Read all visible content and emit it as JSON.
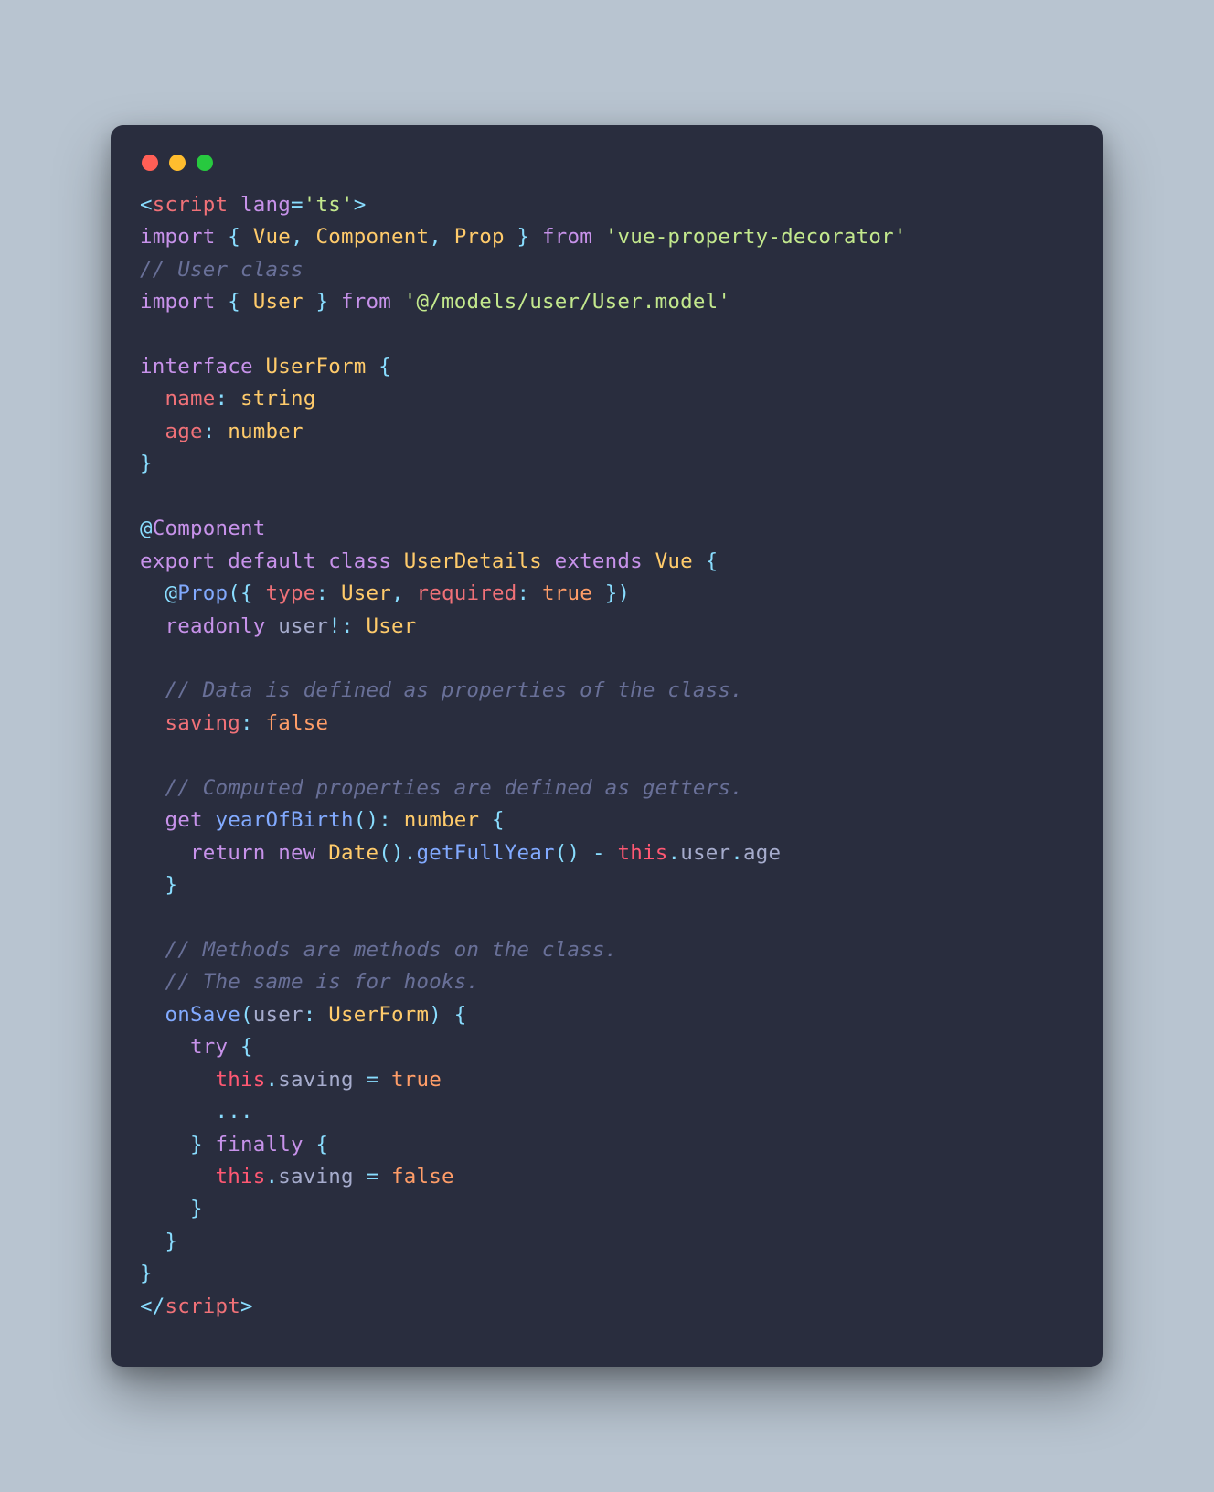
{
  "code_lines": [
    [
      {
        "t": "<",
        "c": "pun"
      },
      {
        "t": "script",
        "c": "tag"
      },
      {
        "t": " ",
        "c": "txt"
      },
      {
        "t": "lang",
        "c": "attr"
      },
      {
        "t": "=",
        "c": "pun"
      },
      {
        "t": "'ts'",
        "c": "str"
      },
      {
        "t": ">",
        "c": "pun"
      }
    ],
    [
      {
        "t": "import",
        "c": "kw"
      },
      {
        "t": " ",
        "c": "txt"
      },
      {
        "t": "{",
        "c": "pun"
      },
      {
        "t": " ",
        "c": "txt"
      },
      {
        "t": "Vue",
        "c": "type"
      },
      {
        "t": ",",
        "c": "pun"
      },
      {
        "t": " ",
        "c": "txt"
      },
      {
        "t": "Component",
        "c": "type"
      },
      {
        "t": ",",
        "c": "pun"
      },
      {
        "t": " ",
        "c": "txt"
      },
      {
        "t": "Prop",
        "c": "type"
      },
      {
        "t": " ",
        "c": "txt"
      },
      {
        "t": "}",
        "c": "pun"
      },
      {
        "t": " ",
        "c": "txt"
      },
      {
        "t": "from",
        "c": "kw"
      },
      {
        "t": " ",
        "c": "txt"
      },
      {
        "t": "'vue-property-decorator'",
        "c": "str"
      }
    ],
    [
      {
        "t": "// User class",
        "c": "comment"
      }
    ],
    [
      {
        "t": "import",
        "c": "kw"
      },
      {
        "t": " ",
        "c": "txt"
      },
      {
        "t": "{",
        "c": "pun"
      },
      {
        "t": " ",
        "c": "txt"
      },
      {
        "t": "User",
        "c": "type"
      },
      {
        "t": " ",
        "c": "txt"
      },
      {
        "t": "}",
        "c": "pun"
      },
      {
        "t": " ",
        "c": "txt"
      },
      {
        "t": "from",
        "c": "kw"
      },
      {
        "t": " ",
        "c": "txt"
      },
      {
        "t": "'@/models/user/User.model'",
        "c": "str"
      }
    ],
    [],
    [
      {
        "t": "interface",
        "c": "kw"
      },
      {
        "t": " ",
        "c": "txt"
      },
      {
        "t": "UserForm",
        "c": "type"
      },
      {
        "t": " ",
        "c": "txt"
      },
      {
        "t": "{",
        "c": "pun"
      }
    ],
    [
      {
        "t": "  ",
        "c": "txt"
      },
      {
        "t": "name",
        "c": "tag"
      },
      {
        "t": ":",
        "c": "pun"
      },
      {
        "t": " ",
        "c": "txt"
      },
      {
        "t": "string",
        "c": "type"
      }
    ],
    [
      {
        "t": "  ",
        "c": "txt"
      },
      {
        "t": "age",
        "c": "tag"
      },
      {
        "t": ":",
        "c": "pun"
      },
      {
        "t": " ",
        "c": "txt"
      },
      {
        "t": "number",
        "c": "type"
      }
    ],
    [
      {
        "t": "}",
        "c": "pun"
      }
    ],
    [],
    [
      {
        "t": "@",
        "c": "meta"
      },
      {
        "t": "Component",
        "c": "deco"
      }
    ],
    [
      {
        "t": "export",
        "c": "kw"
      },
      {
        "t": " ",
        "c": "txt"
      },
      {
        "t": "default",
        "c": "kw"
      },
      {
        "t": " ",
        "c": "txt"
      },
      {
        "t": "class",
        "c": "kw"
      },
      {
        "t": " ",
        "c": "txt"
      },
      {
        "t": "UserDetails",
        "c": "type"
      },
      {
        "t": " ",
        "c": "txt"
      },
      {
        "t": "extends",
        "c": "kw"
      },
      {
        "t": " ",
        "c": "txt"
      },
      {
        "t": "Vue",
        "c": "type"
      },
      {
        "t": " ",
        "c": "txt"
      },
      {
        "t": "{",
        "c": "pun"
      }
    ],
    [
      {
        "t": "  ",
        "c": "txt"
      },
      {
        "t": "@",
        "c": "meta"
      },
      {
        "t": "Prop",
        "c": "fn"
      },
      {
        "t": "(",
        "c": "pun"
      },
      {
        "t": "{",
        "c": "pun"
      },
      {
        "t": " ",
        "c": "txt"
      },
      {
        "t": "type",
        "c": "tag"
      },
      {
        "t": ":",
        "c": "pun"
      },
      {
        "t": " ",
        "c": "txt"
      },
      {
        "t": "User",
        "c": "type"
      },
      {
        "t": ",",
        "c": "pun"
      },
      {
        "t": " ",
        "c": "txt"
      },
      {
        "t": "required",
        "c": "tag"
      },
      {
        "t": ":",
        "c": "pun"
      },
      {
        "t": " ",
        "c": "txt"
      },
      {
        "t": "true",
        "c": "bool"
      },
      {
        "t": " ",
        "c": "txt"
      },
      {
        "t": "}",
        "c": "pun"
      },
      {
        "t": ")",
        "c": "pun"
      }
    ],
    [
      {
        "t": "  ",
        "c": "txt"
      },
      {
        "t": "readonly",
        "c": "kw"
      },
      {
        "t": " ",
        "c": "txt"
      },
      {
        "t": "user",
        "c": "txt"
      },
      {
        "t": "!",
        "c": "pun"
      },
      {
        "t": ":",
        "c": "pun"
      },
      {
        "t": " ",
        "c": "txt"
      },
      {
        "t": "User",
        "c": "type"
      }
    ],
    [],
    [
      {
        "t": "  ",
        "c": "txt"
      },
      {
        "t": "// Data is defined as properties of the class.",
        "c": "comment"
      }
    ],
    [
      {
        "t": "  ",
        "c": "txt"
      },
      {
        "t": "saving",
        "c": "tag"
      },
      {
        "t": ":",
        "c": "pun"
      },
      {
        "t": " ",
        "c": "txt"
      },
      {
        "t": "false",
        "c": "bool"
      }
    ],
    [],
    [
      {
        "t": "  ",
        "c": "txt"
      },
      {
        "t": "// Computed properties are defined as getters.",
        "c": "comment"
      }
    ],
    [
      {
        "t": "  ",
        "c": "txt"
      },
      {
        "t": "get",
        "c": "kw"
      },
      {
        "t": " ",
        "c": "txt"
      },
      {
        "t": "yearOfBirth",
        "c": "fn"
      },
      {
        "t": "(",
        "c": "pun"
      },
      {
        "t": ")",
        "c": "pun"
      },
      {
        "t": ":",
        "c": "pun"
      },
      {
        "t": " ",
        "c": "txt"
      },
      {
        "t": "number",
        "c": "type"
      },
      {
        "t": " ",
        "c": "txt"
      },
      {
        "t": "{",
        "c": "pun"
      }
    ],
    [
      {
        "t": "    ",
        "c": "txt"
      },
      {
        "t": "return",
        "c": "kw"
      },
      {
        "t": " ",
        "c": "txt"
      },
      {
        "t": "new",
        "c": "kw"
      },
      {
        "t": " ",
        "c": "txt"
      },
      {
        "t": "Date",
        "c": "type"
      },
      {
        "t": "(",
        "c": "pun"
      },
      {
        "t": ")",
        "c": "pun"
      },
      {
        "t": ".",
        "c": "pun"
      },
      {
        "t": "getFullYear",
        "c": "fn"
      },
      {
        "t": "(",
        "c": "pun"
      },
      {
        "t": ")",
        "c": "pun"
      },
      {
        "t": " ",
        "c": "txt"
      },
      {
        "t": "-",
        "c": "pun"
      },
      {
        "t": " ",
        "c": "txt"
      },
      {
        "t": "this",
        "c": "this"
      },
      {
        "t": ".",
        "c": "pun"
      },
      {
        "t": "user",
        "c": "txt"
      },
      {
        "t": ".",
        "c": "pun"
      },
      {
        "t": "age",
        "c": "txt"
      }
    ],
    [
      {
        "t": "  ",
        "c": "txt"
      },
      {
        "t": "}",
        "c": "pun"
      }
    ],
    [],
    [
      {
        "t": "  ",
        "c": "txt"
      },
      {
        "t": "// Methods are methods on the class.",
        "c": "comment"
      }
    ],
    [
      {
        "t": "  ",
        "c": "txt"
      },
      {
        "t": "// The same is for hooks.",
        "c": "comment"
      }
    ],
    [
      {
        "t": "  ",
        "c": "txt"
      },
      {
        "t": "onSave",
        "c": "fn"
      },
      {
        "t": "(",
        "c": "pun"
      },
      {
        "t": "user",
        "c": "txt"
      },
      {
        "t": ":",
        "c": "pun"
      },
      {
        "t": " ",
        "c": "txt"
      },
      {
        "t": "UserForm",
        "c": "type"
      },
      {
        "t": ")",
        "c": "pun"
      },
      {
        "t": " ",
        "c": "txt"
      },
      {
        "t": "{",
        "c": "pun"
      }
    ],
    [
      {
        "t": "    ",
        "c": "txt"
      },
      {
        "t": "try",
        "c": "kw"
      },
      {
        "t": " ",
        "c": "txt"
      },
      {
        "t": "{",
        "c": "pun"
      }
    ],
    [
      {
        "t": "      ",
        "c": "txt"
      },
      {
        "t": "this",
        "c": "this"
      },
      {
        "t": ".",
        "c": "pun"
      },
      {
        "t": "saving",
        "c": "txt"
      },
      {
        "t": " ",
        "c": "txt"
      },
      {
        "t": "=",
        "c": "pun"
      },
      {
        "t": " ",
        "c": "txt"
      },
      {
        "t": "true",
        "c": "bool"
      }
    ],
    [
      {
        "t": "      ",
        "c": "txt"
      },
      {
        "t": "...",
        "c": "pun"
      }
    ],
    [
      {
        "t": "    ",
        "c": "txt"
      },
      {
        "t": "}",
        "c": "pun"
      },
      {
        "t": " ",
        "c": "txt"
      },
      {
        "t": "finally",
        "c": "kw"
      },
      {
        "t": " ",
        "c": "txt"
      },
      {
        "t": "{",
        "c": "pun"
      }
    ],
    [
      {
        "t": "      ",
        "c": "txt"
      },
      {
        "t": "this",
        "c": "this"
      },
      {
        "t": ".",
        "c": "pun"
      },
      {
        "t": "saving",
        "c": "txt"
      },
      {
        "t": " ",
        "c": "txt"
      },
      {
        "t": "=",
        "c": "pun"
      },
      {
        "t": " ",
        "c": "txt"
      },
      {
        "t": "false",
        "c": "bool"
      }
    ],
    [
      {
        "t": "    ",
        "c": "txt"
      },
      {
        "t": "}",
        "c": "pun"
      }
    ],
    [
      {
        "t": "  ",
        "c": "txt"
      },
      {
        "t": "}",
        "c": "pun"
      }
    ],
    [
      {
        "t": "}",
        "c": "pun"
      }
    ],
    [
      {
        "t": "</",
        "c": "pun"
      },
      {
        "t": "script",
        "c": "tag"
      },
      {
        "t": ">",
        "c": "pun"
      }
    ]
  ]
}
